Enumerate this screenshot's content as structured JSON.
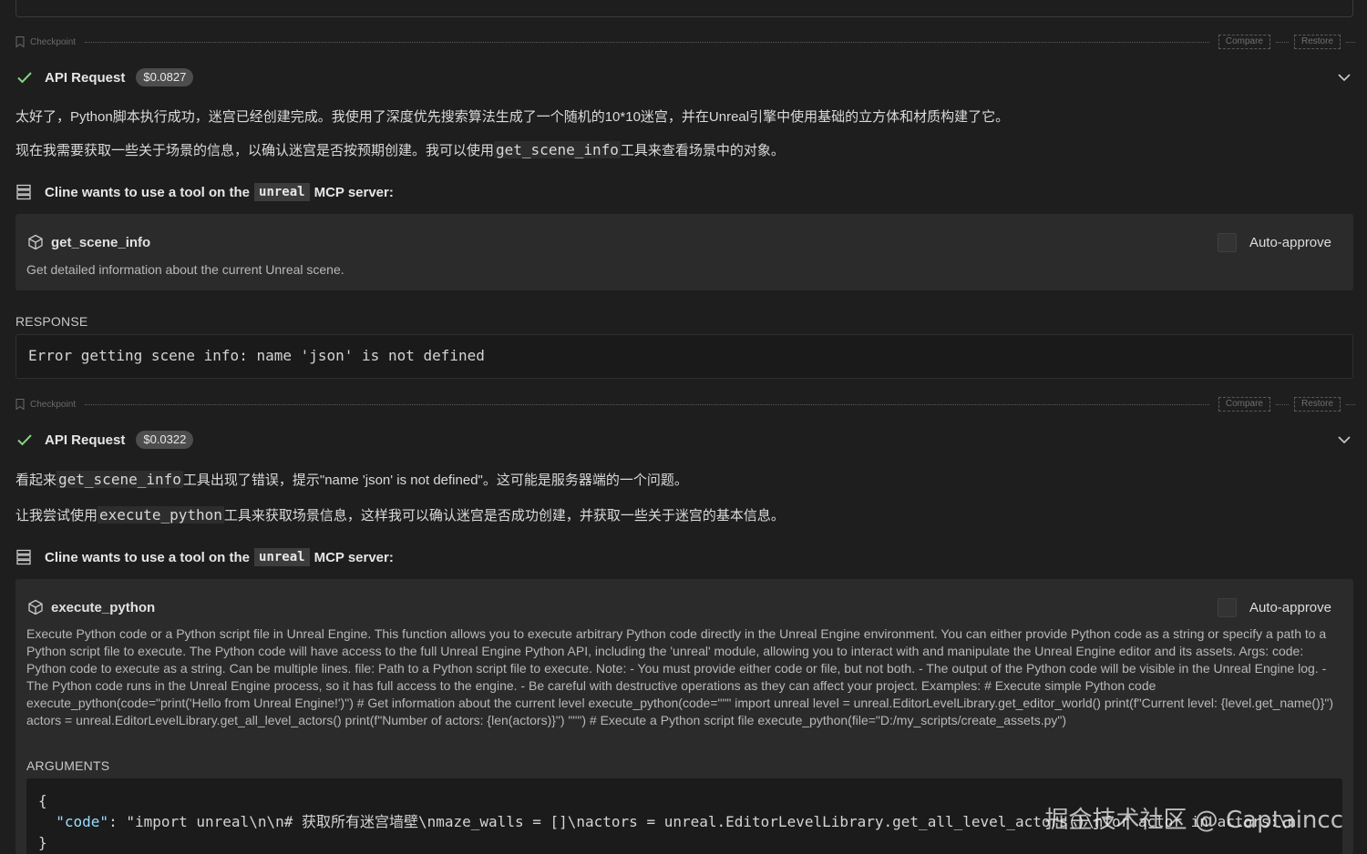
{
  "checkpoint": {
    "label": "Checkpoint",
    "compare_label": "Compare",
    "restore_label": "Restore"
  },
  "blocks": [
    {
      "api_request": {
        "title": "API Request",
        "cost": "$0.0827"
      },
      "paragraph_1": "太好了，Python脚本执行成功，迷宫已经创建完成。我使用了深度优先搜索算法生成了一个随机的10*10迷宫，并在Unreal引擎中使用基础的立方体和材质构建了它。",
      "paragraph_2": {
        "before": "现在我需要获取一些关于场景的信息，以确认迷宫是否按预期创建。我可以使用",
        "code": "get_scene_info",
        "after": "工具来查看场景中的对象。"
      },
      "mcp": {
        "prefix": "Cline wants to use a tool on the",
        "server": "unreal",
        "suffix": "MCP server:"
      },
      "tool": {
        "name": "get_scene_info",
        "description": "Get detailed information about the current Unreal scene.",
        "auto_approve_label": "Auto-approve"
      },
      "response": {
        "label": "RESPONSE",
        "text": "Error getting scene info: name 'json' is not defined"
      }
    },
    {
      "api_request": {
        "title": "API Request",
        "cost": "$0.0322"
      },
      "paragraph_1": {
        "before": "看起来",
        "code": "get_scene_info",
        "after": "工具出现了错误，提示\"name 'json' is not defined\"。这可能是服务器端的一个问题。"
      },
      "paragraph_2": {
        "before": "让我尝试使用",
        "code": "execute_python",
        "after": "工具来获取场景信息，这样我可以确认迷宫是否成功创建，并获取一些关于迷宫的基本信息。"
      },
      "mcp": {
        "prefix": "Cline wants to use a tool on the",
        "server": "unreal",
        "suffix": "MCP server:"
      },
      "tool": {
        "name": "execute_python",
        "description": "Execute Python code or a Python script file in Unreal Engine. This function allows you to execute arbitrary Python code directly in the Unreal Engine environment. You can either provide Python code as a string or specify a path to a Python script file to execute. The Python code will have access to the full Unreal Engine Python API, including the 'unreal' module, allowing you to interact with and manipulate the Unreal Engine editor and its assets. Args: code: Python code to execute as a string. Can be multiple lines. file: Path to a Python script file to execute. Note: - You must provide either code or file, but not both. - The output of the Python code will be visible in the Unreal Engine log. - The Python code runs in the Unreal Engine process, so it has full access to the engine. - Be careful with destructive operations as they can affect your project. Examples: # Execute simple Python code execute_python(code=\"print('Hello from Unreal Engine!')\") # Get information about the current level execute_python(code=\"\"\" import unreal level = unreal.EditorLevelLibrary.get_editor_world() print(f\"Current level: {level.get_name()}\") actors = unreal.EditorLevelLibrary.get_all_level_actors() print(f\"Number of actors: {len(actors)}\") \"\"\") # Execute a Python script file execute_python(file=\"D:/my_scripts/create_assets.py\")",
        "auto_approve_label": "Auto-approve",
        "arguments_label": "ARGUMENTS",
        "arguments": {
          "open_brace": "{",
          "key": "\"code\"",
          "colon": ": ",
          "value": "\"import unreal\\n\\n# 获取所有迷宫墙壁\\nmaze_walls = []\\nactors = unreal.EditorLevelLibrary.get_all_level_actors()\\nfor actor in actors:\\n",
          "close_brace": "}"
        }
      }
    }
  ],
  "watermark": "掘金技术社区 @ Captaincc",
  "icons": [
    "bookmark-icon",
    "check-icon",
    "chevron-down-icon",
    "server-icon",
    "cube-icon"
  ],
  "colors": {
    "background": "#1e1e1e",
    "card": "#2b2b2b",
    "badge": "#4d4d4d",
    "check": "#89d185"
  }
}
